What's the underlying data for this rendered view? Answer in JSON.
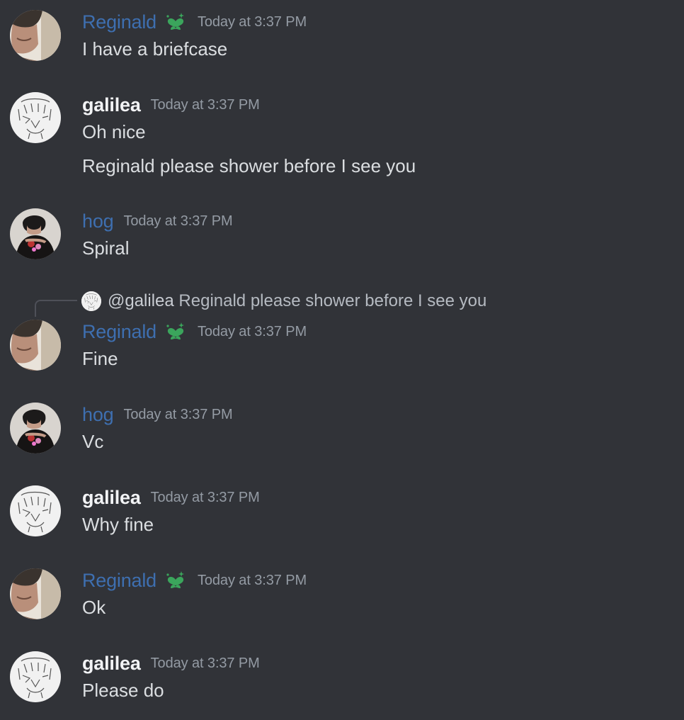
{
  "colors": {
    "background": "#313338",
    "role_blue": "#3e6fb0",
    "text": "#dbdee1",
    "timestamp": "#949ba4",
    "badge_green": "#3ba55c"
  },
  "messages": [
    {
      "user": "Reginald",
      "timestamp": "Today at 3:37 PM",
      "lines": [
        "I have a briefcase"
      ],
      "badge": "green-heart-flower-icon"
    },
    {
      "user": "galilea",
      "timestamp": "Today at 3:37 PM",
      "lines": [
        "Oh nice",
        "Reginald please shower before I see you"
      ]
    },
    {
      "user": "hog",
      "timestamp": "Today at 3:37 PM",
      "lines": [
        "Spiral"
      ]
    },
    {
      "user": "Reginald",
      "timestamp": "Today at 3:37 PM",
      "lines": [
        "Fine"
      ],
      "badge": "green-heart-flower-icon",
      "reply": {
        "mention": "@galilea",
        "text": "Reginald please shower before I see you"
      }
    },
    {
      "user": "hog",
      "timestamp": "Today at 3:37 PM",
      "lines": [
        "Vc"
      ]
    },
    {
      "user": "galilea",
      "timestamp": "Today at 3:37 PM",
      "lines": [
        "Why fine"
      ]
    },
    {
      "user": "Reginald",
      "timestamp": "Today at 3:37 PM",
      "lines": [
        "Ok"
      ],
      "badge": "green-heart-flower-icon"
    },
    {
      "user": "galilea",
      "timestamp": "Today at 3:37 PM",
      "lines": [
        "Please do"
      ]
    }
  ]
}
